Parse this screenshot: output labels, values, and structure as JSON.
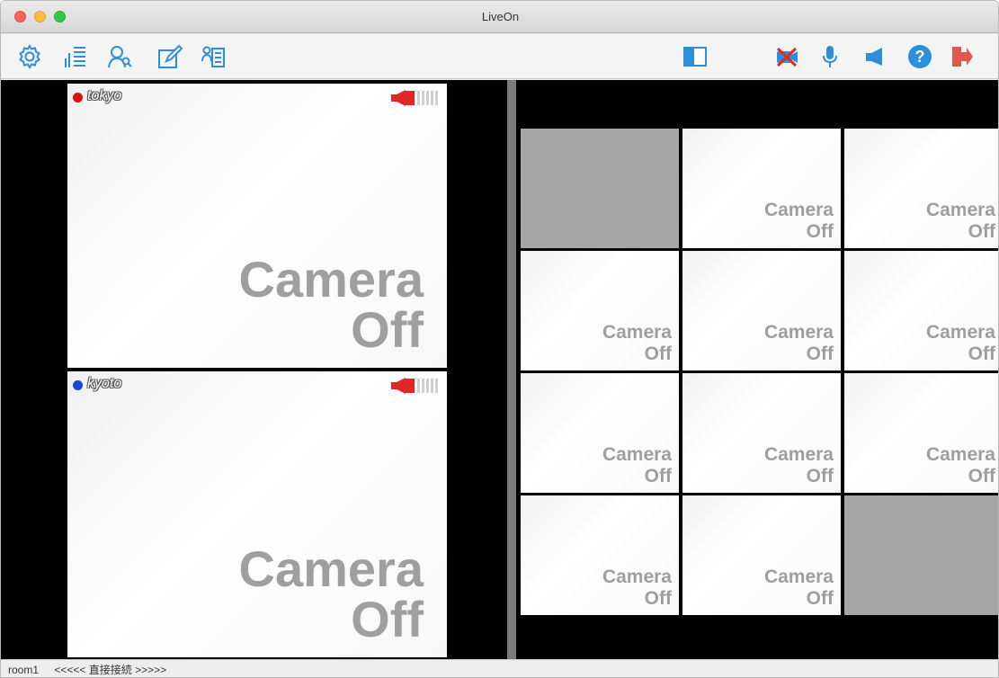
{
  "window": {
    "title": "LiveOn"
  },
  "toolbar": {
    "left_icons": [
      "gear-icon",
      "level-meter-icon",
      "user-search-icon",
      "edit-icon",
      "member-list-icon"
    ],
    "right_icons": [
      "layout-toggle-icon",
      "camera-muted-icon",
      "microphone-icon",
      "speaker-icon",
      "help-icon",
      "exit-icon"
    ]
  },
  "colors": {
    "accent": "#2b8fdb",
    "mute_red": "#e0282a",
    "exit_red": "#e2574c",
    "user_tokyo": "#e01010",
    "user_kyoto": "#1a44d6"
  },
  "participants": [
    {
      "name": "tokyo",
      "status_label": "Camera\nOff",
      "line1": "Camera",
      "line2": "Off"
    },
    {
      "name": "kyoto",
      "status_label": "Camera\nOff",
      "line1": "Camera",
      "line2": "Off"
    }
  ],
  "grid": {
    "line1": "Camera",
    "line2": "Off"
  },
  "status": {
    "room": "room1",
    "connection": "<<<<< 直接接続 >>>>>"
  }
}
